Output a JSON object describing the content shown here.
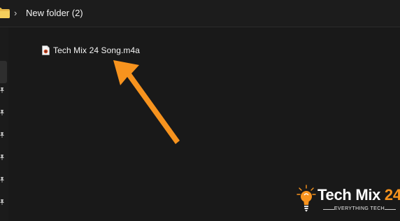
{
  "breadcrumb": {
    "separator": "›",
    "current": "New folder (2)"
  },
  "file": {
    "name": "Tech Mix 24 Song.m4a",
    "icon": "audio-file-icon"
  },
  "annotation": {
    "type": "arrow",
    "color": "#f7931e"
  },
  "watermark": {
    "title_part1": "Tech Mix",
    "title_part2": "24",
    "tagline": "EVERYTHING TECH",
    "accent": "#f7931e"
  },
  "icons": {
    "folder": "folder-icon",
    "pin": "pin-icon",
    "bulb": "bulb-icon"
  }
}
